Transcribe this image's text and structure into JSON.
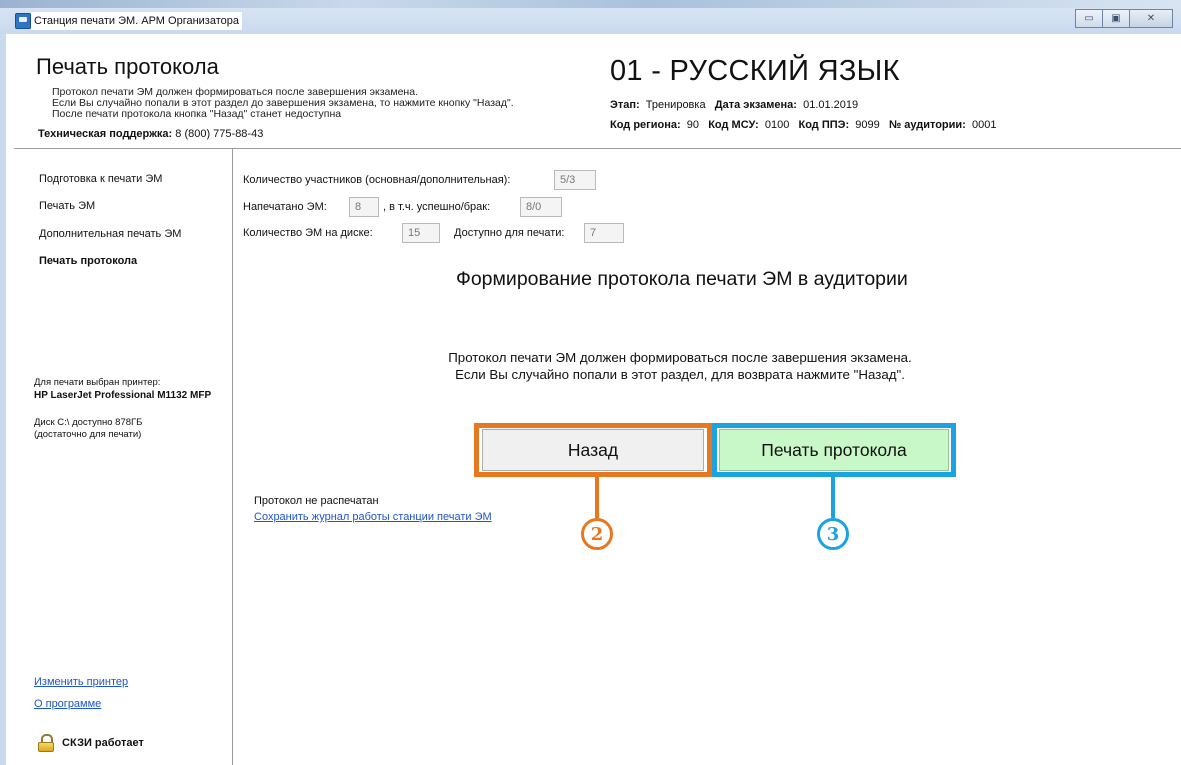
{
  "window": {
    "title": "Станция печати ЭМ. АРМ Организатора",
    "controls": {
      "minimize": "▭",
      "maximize": "▣",
      "close": "✕"
    }
  },
  "header": {
    "title": "Печать протокола",
    "notes": [
      "Протокол печати ЭМ должен формироваться после завершения экзамена.",
      "Если Вы случайно попали в этот раздел до завершения экзамена, то нажмите кнопку \"Назад\".",
      "После печати протокола кнопка \"Назад\" станет недоступна"
    ],
    "support_label": "Техническая поддержка:",
    "support_phone": "8 (800) 775-88-43",
    "exam_title": "01 - РУССКИЙ ЯЗЫК",
    "stage_label": "Этап:",
    "stage_value": "Тренировка",
    "date_label": "Дата экзамена:",
    "date_value": "01.01.2019",
    "region_label": "Код региона:",
    "region_value": "90",
    "msu_label": "Код МСУ:",
    "msu_value": "0100",
    "ppe_label": "Код ППЭ:",
    "ppe_value": "9099",
    "room_label": "№ аудитории:",
    "room_value": "0001"
  },
  "sidebar": {
    "items": [
      {
        "label": "Подготовка к печати ЭМ"
      },
      {
        "label": "Печать ЭМ"
      },
      {
        "label": "Дополнительная печать ЭМ"
      },
      {
        "label": "Печать протокола",
        "active": true
      }
    ],
    "printer_label": "Для печати выбран принтер:",
    "printer_name": "HP LaserJet Professional M1132 MFP",
    "disk_line1": "Диск C:\\ доступно 878ГБ",
    "disk_line2": "(достаточно для печати)",
    "change_printer": "Изменить принтер",
    "about": "О программе",
    "skzi_status": "СКЗИ работает"
  },
  "stats": {
    "participants_label": "Количество участников (основная/дополнительная):",
    "participants_value": "5/3",
    "printed_label": "Напечатано ЭМ:",
    "printed_value": "8",
    "success_label": ", в т.ч. успешно/брак:",
    "success_value": "8/0",
    "disk_em_label": "Количество ЭМ на диске:",
    "disk_em_value": "15",
    "available_label": "Доступно для печати:",
    "available_value": "7"
  },
  "main": {
    "heading": "Формирование протокола печати ЭМ в аудитории",
    "message_line1": "Протокол печати ЭМ должен формироваться после завершения экзамена.",
    "message_line2": "Если Вы случайно попали в этот раздел, для возврата нажмите \"Назад\".",
    "back_button": "Назад",
    "print_button": "Печать протокола",
    "status": "Протокол не распечатан",
    "save_log": "Сохранить журнал работы станции печати ЭМ"
  },
  "annotations": {
    "back_badge": "2",
    "print_badge": "3",
    "back_color": "#e87820",
    "print_color": "#1aa3e0"
  }
}
